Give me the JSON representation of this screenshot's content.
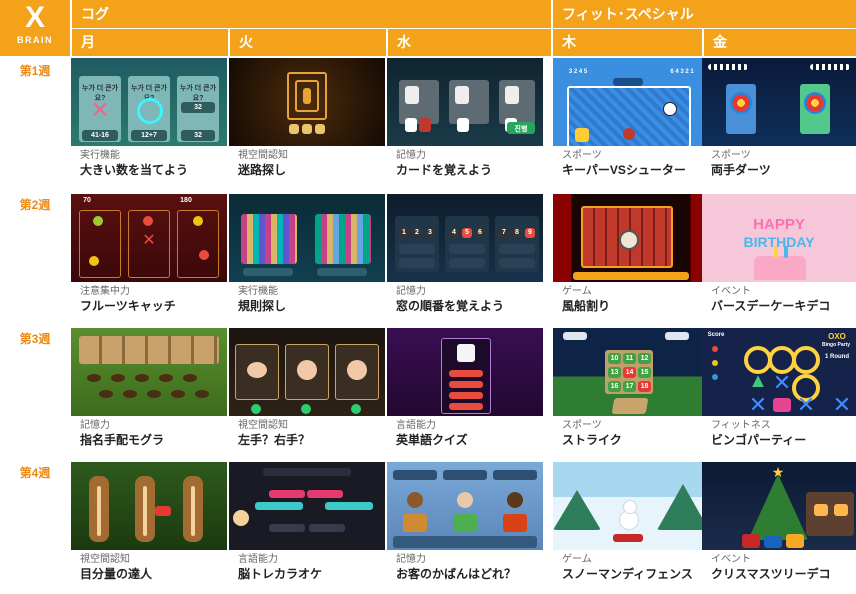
{
  "logo": {
    "mark": "X",
    "text": "BRAIN"
  },
  "categories": [
    "コグ",
    "フィット･スペシャル"
  ],
  "days": [
    "月",
    "火",
    "水",
    "木",
    "金"
  ],
  "weeks": [
    "第1週",
    "第2週",
    "第3週",
    "第4週"
  ],
  "rows": [
    [
      {
        "category": "実行機能",
        "title": "大きい数を当てよう",
        "thumb_text": [
          "누가 더 큰가요?",
          "누가 더 큰가요?",
          "누가 더 큰가요?",
          "41-16",
          "12+7",
          "32",
          "32",
          "같음:0.0"
        ]
      },
      {
        "category": "視空間認知",
        "title": "迷路探し",
        "thumb_text": []
      },
      {
        "category": "記憶力",
        "title": "カードを覚えよう",
        "thumb_text": [
          "진행"
        ]
      },
      {
        "category": "スポーツ",
        "title": "キーパーVSシューター",
        "thumb_text": [
          "3 2 4 5",
          "6 4 3 2 1"
        ]
      },
      {
        "category": "スポーツ",
        "title": "両手ダーツ",
        "thumb_text": []
      }
    ],
    [
      {
        "category": "注意集中力",
        "title": "フルーツキャッチ",
        "thumb_text": [
          "70",
          "180"
        ]
      },
      {
        "category": "実行機能",
        "title": "規則探し",
        "thumb_text": []
      },
      {
        "category": "記憶力",
        "title": "窓の順番を覚えよう",
        "thumb_text": [
          "1",
          "2",
          "3",
          "4",
          "5",
          "6",
          "7",
          "8",
          "9"
        ]
      },
      {
        "category": "ゲーム",
        "title": "風船割り",
        "thumb_text": []
      },
      {
        "category": "イベント",
        "title": "バースデーケーキデコ",
        "thumb_text": [
          "HAPPY",
          "BIRTHDAY"
        ]
      }
    ],
    [
      {
        "category": "記憶力",
        "title": "指名手配モグラ",
        "thumb_text": []
      },
      {
        "category": "視空間認知",
        "title": "左手？右手？",
        "thumb_text": []
      },
      {
        "category": "言語能力",
        "title": "英単語クイズ",
        "thumb_text": []
      },
      {
        "category": "スポーツ",
        "title": "ストライク",
        "thumb_text": [
          "10",
          "11",
          "12",
          "13",
          "14",
          "15",
          "16",
          "17",
          "18"
        ]
      },
      {
        "category": "フィットネス",
        "title": "ビンゴパーティー",
        "thumb_text": [
          "OXO",
          "Bingo Party",
          "Score",
          "1 Round"
        ]
      }
    ],
    [
      {
        "category": "視空間認知",
        "title": "目分量の達人",
        "thumb_text": []
      },
      {
        "category": "言語能力",
        "title": "脳トレカラオケ",
        "thumb_text": []
      },
      {
        "category": "記憶力",
        "title": "お客のかばんはどれ？",
        "thumb_text": []
      },
      {
        "category": "ゲーム",
        "title": "スノーマンディフェンス",
        "thumb_text": []
      },
      {
        "category": "イベント",
        "title": "クリスマスツリーデコ",
        "thumb_text": []
      }
    ]
  ],
  "colors": {
    "accent": "#f5a21b",
    "week_label": "#ef8a12"
  }
}
